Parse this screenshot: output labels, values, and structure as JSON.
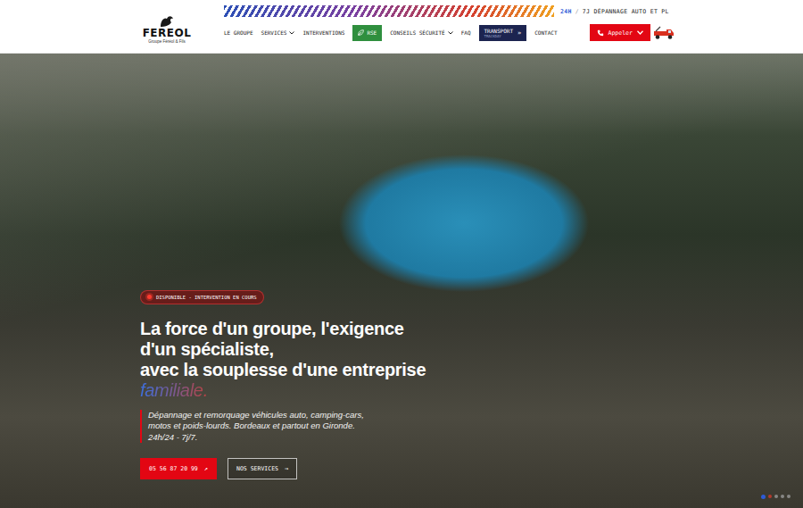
{
  "header": {
    "top_bar": {
      "highlight": "24H",
      "separator": "/",
      "text": "7J DÉPANNAGE AUTO ET PL"
    },
    "logo": {
      "name": "FEREOL",
      "subtitle": "Groupe Féréol & Fils"
    },
    "nav": [
      {
        "label": "LE GROUPE",
        "kind": "link"
      },
      {
        "label": "SERVICES",
        "kind": "dropdown"
      },
      {
        "label": "INTERVENTIONS",
        "kind": "link"
      },
      {
        "label": "RSE",
        "kind": "pill-green"
      },
      {
        "label": "CONSEILS SÉCURITÉ",
        "kind": "dropdown"
      },
      {
        "label": "FAQ",
        "kind": "link"
      },
      {
        "label": "TRANSPORT",
        "sub": "TRACKDAY",
        "icon": "»",
        "kind": "pill-dark"
      },
      {
        "label": "CONTACT",
        "kind": "link"
      }
    ],
    "call_button": {
      "label": "Appeler"
    }
  },
  "hero": {
    "badge": "DISPONIBLE - INTERVENTION EN COURS",
    "heading_lines": [
      "La force d'un groupe, l'exigence",
      "d'un spécialiste,",
      "avec la souplesse d'une entreprise"
    ],
    "heading_accent": "familiale.",
    "description_lines": [
      "Dépannage et remorquage véhicules auto, camping-cars,",
      "motos et poids-lourds. Bordeaux et partout en Gironde.",
      "24h/24 - 7j/7."
    ],
    "buttons": [
      {
        "label": "05 56 87 20 99",
        "icon": "↗",
        "kind": "primary"
      },
      {
        "label": "NOS SERVICES",
        "icon": "→",
        "kind": "outline"
      }
    ],
    "carousel": [
      {
        "selected": true,
        "color": "#2d5bd7"
      },
      {
        "selected": false,
        "color": "#d23a2c"
      },
      {
        "selected": false,
        "color": "#9a9a9a"
      },
      {
        "selected": false,
        "color": "#9a9a9a"
      },
      {
        "selected": false,
        "color": "#9a9a9a"
      }
    ]
  }
}
